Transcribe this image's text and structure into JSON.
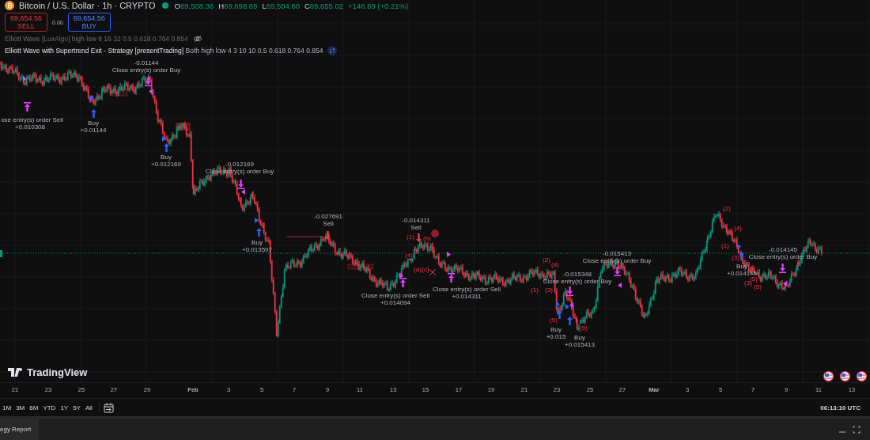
{
  "symbol": {
    "title": "Bitcoin / U.S. Dollar · 1h · CRYPTO",
    "ohlc": [
      {
        "key": "O",
        "value": "69,508.36"
      },
      {
        "key": "H",
        "value": "69,698.69"
      },
      {
        "key": "L",
        "value": "69,504.60"
      },
      {
        "key": "C",
        "value": "69,655.02"
      }
    ],
    "change": "+146.69 (+0.21%)"
  },
  "trade": {
    "sell_price": "69,654.56",
    "sell_label": "SELL",
    "spread": "0.00",
    "buy_price": "69,654.56",
    "buy_label": "BUY"
  },
  "indicators": [
    {
      "name": "Elliott Wave [LuxAlgo]",
      "params": "high low 8 16 32 0.5 0.618 0.764 0.854",
      "hidden": true
    },
    {
      "name": "Elliott Wave with Supertrend Exit - Strategy [presentTrading]",
      "params": "Both high low 4 3 10 10 0.5 0.618 0.764 0.854",
      "hidden": false
    }
  ],
  "annotations": [
    {
      "lines": [
        "-0.01144",
        "Close entry(s) order Buy"
      ]
    },
    {
      "lines": [
        "ose entry(s) order Sell",
        "+0.010308"
      ]
    },
    {
      "lines": [
        "Buy",
        "+0.01144"
      ]
    },
    {
      "lines": [
        "Buy",
        "+0.012169"
      ]
    },
    {
      "lines": [
        "-0.012169",
        "Close entry(s) order Buy"
      ]
    },
    {
      "lines": [
        "Buy",
        "+0.013597"
      ]
    },
    {
      "lines": [
        "-0.027691",
        "Sell"
      ]
    },
    {
      "lines": [
        "-0.014311",
        "Sell"
      ]
    },
    {
      "lines": [
        "Close entry(s) order Sell",
        "+0.014094"
      ]
    },
    {
      "lines": [
        "Close entry(s) order Sell",
        "+0.014311"
      ]
    },
    {
      "lines": [
        "-0.015348",
        "Close entry(s) order Buy"
      ]
    },
    {
      "lines": [
        "Buy",
        "+0.015"
      ]
    },
    {
      "lines": [
        "Buy",
        "+0.015413"
      ]
    },
    {
      "lines": [
        "-0.015413",
        "Close entry(s) order Buy"
      ]
    },
    {
      "lines": [
        "Buy",
        "+0.014145"
      ]
    },
    {
      "lines": [
        "-0.014145",
        "Close entry(s) order Buy"
      ]
    }
  ],
  "waves": [
    "(1)",
    "(b)",
    "(4)",
    "(a)",
    "(c)",
    "(2)",
    "(4)",
    "(1)",
    "(3)",
    "(5)",
    "(5)",
    "(2)",
    "(4)",
    "(1)",
    "(3)",
    "(3)",
    "(5)",
    "(5)"
  ],
  "markers": [
    {
      "kind": "entry"
    },
    {
      "kind": "close-short"
    },
    {
      "kind": "long"
    },
    {
      "kind": "buy"
    },
    {
      "kind": "close-long"
    },
    {
      "kind": "exit"
    },
    {
      "kind": "long"
    },
    {
      "kind": "buy"
    },
    {
      "kind": "close-long"
    },
    {
      "kind": "exit"
    },
    {
      "kind": "long"
    },
    {
      "kind": "buy"
    },
    {
      "kind": "sell"
    },
    {
      "kind": "entry"
    },
    {
      "kind": "close-short"
    },
    {
      "kind": "sell"
    },
    {
      "kind": "entry"
    },
    {
      "kind": "close-short"
    },
    {
      "kind": "long"
    },
    {
      "kind": "buy"
    },
    {
      "kind": "close-long"
    },
    {
      "kind": "exit"
    },
    {
      "kind": "buy"
    },
    {
      "kind": "long"
    },
    {
      "kind": "close-long"
    },
    {
      "kind": "exit"
    },
    {
      "kind": "long"
    },
    {
      "kind": "buy"
    },
    {
      "kind": "close-long"
    },
    {
      "kind": "exit"
    }
  ],
  "x_axis": [
    "21",
    "23",
    "25",
    "27",
    "29",
    "Feb",
    "3",
    "5",
    "7",
    "9",
    "11",
    "13",
    "15",
    "17",
    "19",
    "21",
    "23",
    "25",
    "27",
    "Mar",
    "3",
    "5",
    "7",
    "9",
    "11",
    "13"
  ],
  "ranges": [
    "1M",
    "3M",
    "6M",
    "YTD",
    "1Y",
    "5Y",
    "All"
  ],
  "brand": "TradingView",
  "clock": "06:13:10 UTC",
  "bottom_tab": "egy Report"
}
